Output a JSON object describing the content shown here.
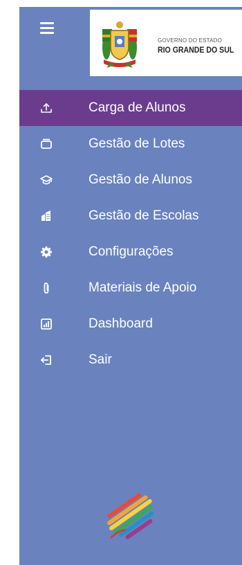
{
  "header": {
    "menu_icon": "hamburger-icon",
    "logo": {
      "line1": "GOVERNO DO ESTADO",
      "line2": "RIO GRANDE DO SUL",
      "crest_icon": "state-coat-of-arms"
    }
  },
  "menu": {
    "items": [
      {
        "label": "Carga de Alunos",
        "icon": "upload-icon",
        "active": true
      },
      {
        "label": "Gestão de Lotes",
        "icon": "inbox-icon",
        "active": false
      },
      {
        "label": "Gestão de Alunos",
        "icon": "graduation-cap-icon",
        "active": false
      },
      {
        "label": "Gestão de Escolas",
        "icon": "building-icon",
        "active": false
      },
      {
        "label": "Configurações",
        "icon": "gear-icon",
        "active": false
      },
      {
        "label": "Materiais de Apoio",
        "icon": "paperclip-icon",
        "active": false
      },
      {
        "label": "Dashboard",
        "icon": "chart-icon",
        "active": false
      },
      {
        "label": "Sair",
        "icon": "logout-icon",
        "active": false
      }
    ]
  },
  "footer": {
    "brand_icon": "colorful-stripes-logo"
  },
  "colors": {
    "sidebar_bg": "#6a83bf",
    "active_bg": "#6b3c8e",
    "text": "#ffffff"
  }
}
